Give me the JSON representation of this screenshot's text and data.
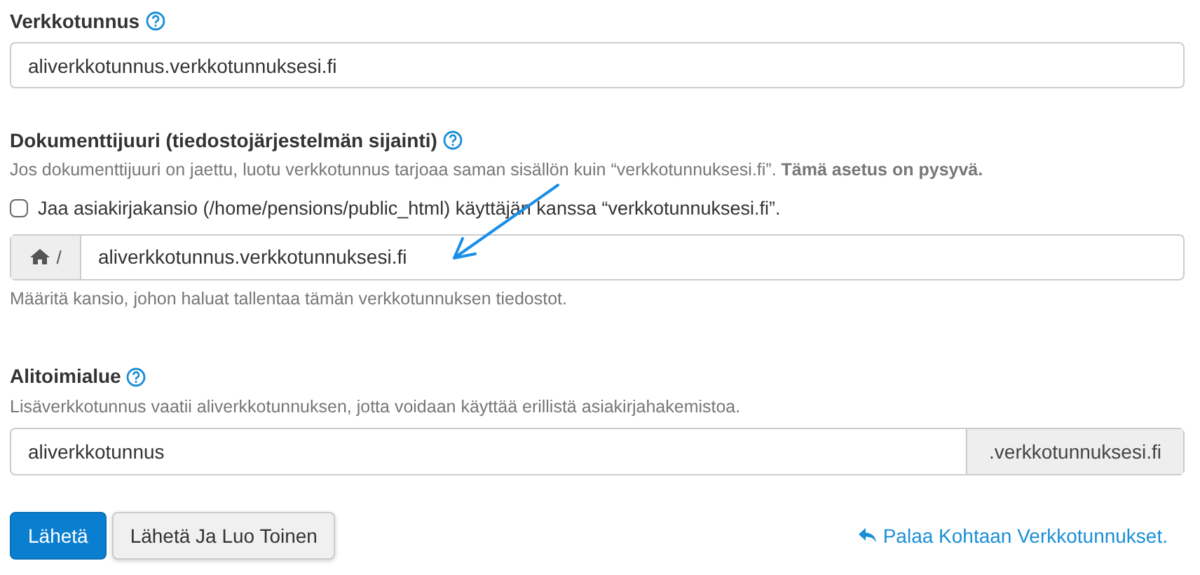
{
  "domain": {
    "label": "Verkkotunnus",
    "value": "aliverkkotunnus.verkkotunnuksesi.fi"
  },
  "document_root": {
    "label": "Dokumenttijuuri (tiedostojärjestelmän sijainti)",
    "help": "Jos dokumenttijuuri on jaettu, luotu verkkotunnus tarjoaa saman sisällön kuin “verkkotunnuksesi.fi”. **Tämä asetus on pysyvä.**",
    "share_checkbox": {
      "label": "Jaa asiakirjakansio (/home/pensions/public_html) käyttäjän kanssa “verkkotunnuksesi.fi”.",
      "checked": false
    },
    "prefix": "/",
    "value": "aliverkkotunnus.verkkotunnuksesi.fi",
    "hint": "Määritä kansio, johon haluat tallentaa tämän verkkotunnuksen tiedostot."
  },
  "subdomain": {
    "label": "Alitoimialue",
    "help": "Lisäverkkotunnus vaatii aliverkkotunnuksen, jotta voidaan käyttää erillistä asiakirjahakemistoa.",
    "value": "aliverkkotunnus",
    "suffix": ".verkkotunnuksesi.fi"
  },
  "buttons": [
    {
      "label": "Lähetä",
      "kind": "primary"
    },
    {
      "label": "Lähetä Ja Luo Toinen",
      "kind": "secondary"
    }
  ],
  "back_link": "Palaa Kohtaan Verkkotunnukset."
}
